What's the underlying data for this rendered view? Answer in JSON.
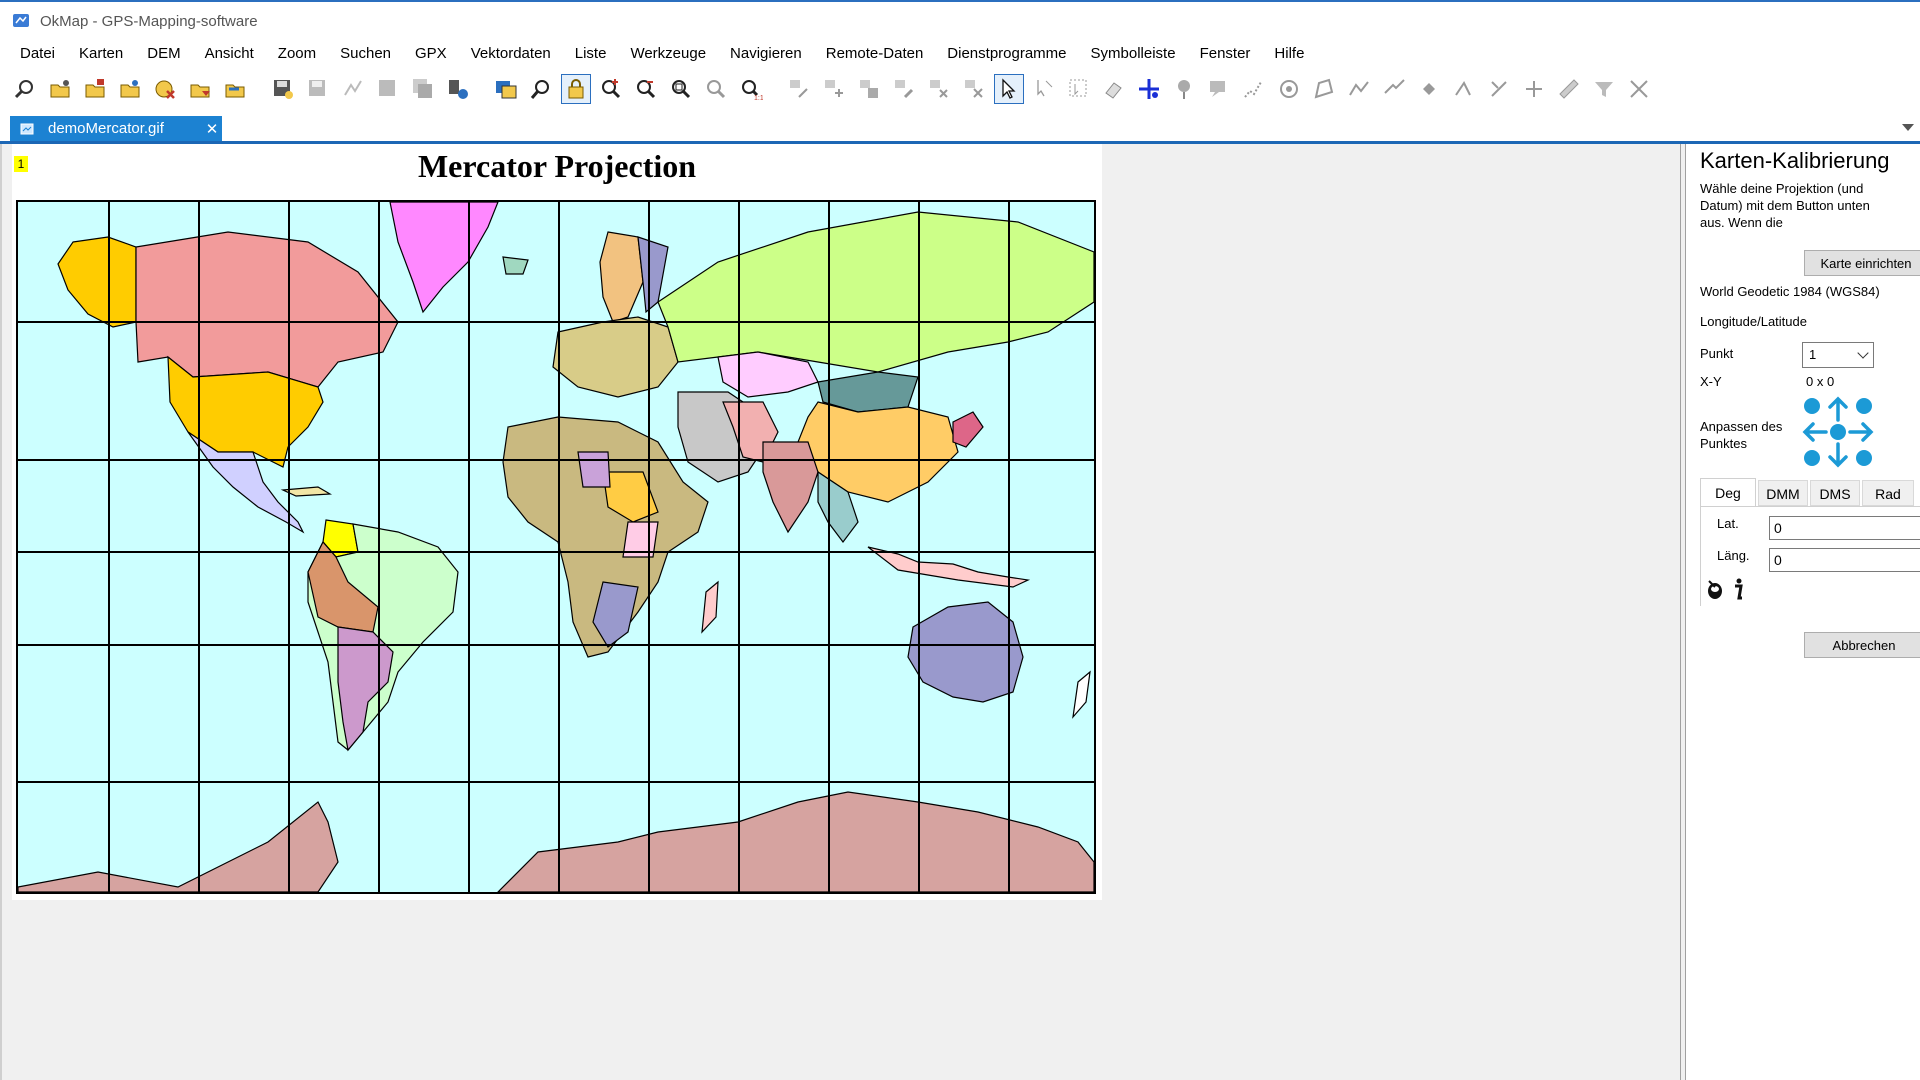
{
  "window": {
    "title": "OkMap - GPS-Mapping-software"
  },
  "menu": [
    "Datei",
    "Karten",
    "DEM",
    "Ansicht",
    "Zoom",
    "Suchen",
    "GPX",
    "Vektordaten",
    "Liste",
    "Werkzeuge",
    "Navigieren",
    "Remote-Daten",
    "Dienstprogramme",
    "Symbolleiste",
    "Fenster",
    "Hilfe"
  ],
  "document_tab": {
    "label": "demoMercator.gif",
    "close": "✕"
  },
  "map": {
    "title": "Mercator Projection",
    "calibration_marker": "1"
  },
  "panel": {
    "title": "Karten-Kalibrierung",
    "description": "Wähle deine Projektion (und Datum) mit dem Button unten aus. Wenn die",
    "setup_button": "Karte einrichten",
    "datum": "World Geodetic 1984 (WGS84)",
    "coord_system": "Longitude/Latitude",
    "point_label": "Punkt",
    "point_value": "1",
    "xy_label": "X-Y",
    "xy_value": "0 x 0",
    "adjust_label": "Anpassen des Punktes",
    "tabs": [
      "Deg",
      "DMM",
      "DMS",
      "Rad"
    ],
    "lat_label": "Lat.",
    "lat_value": "0",
    "lon_label": "Läng.",
    "lon_value": "0",
    "cancel_button": "Abbrechen"
  },
  "colors": {
    "accent": "#1c82d2",
    "ocean": "#ccffff",
    "adjust": "#1c9ad6"
  }
}
